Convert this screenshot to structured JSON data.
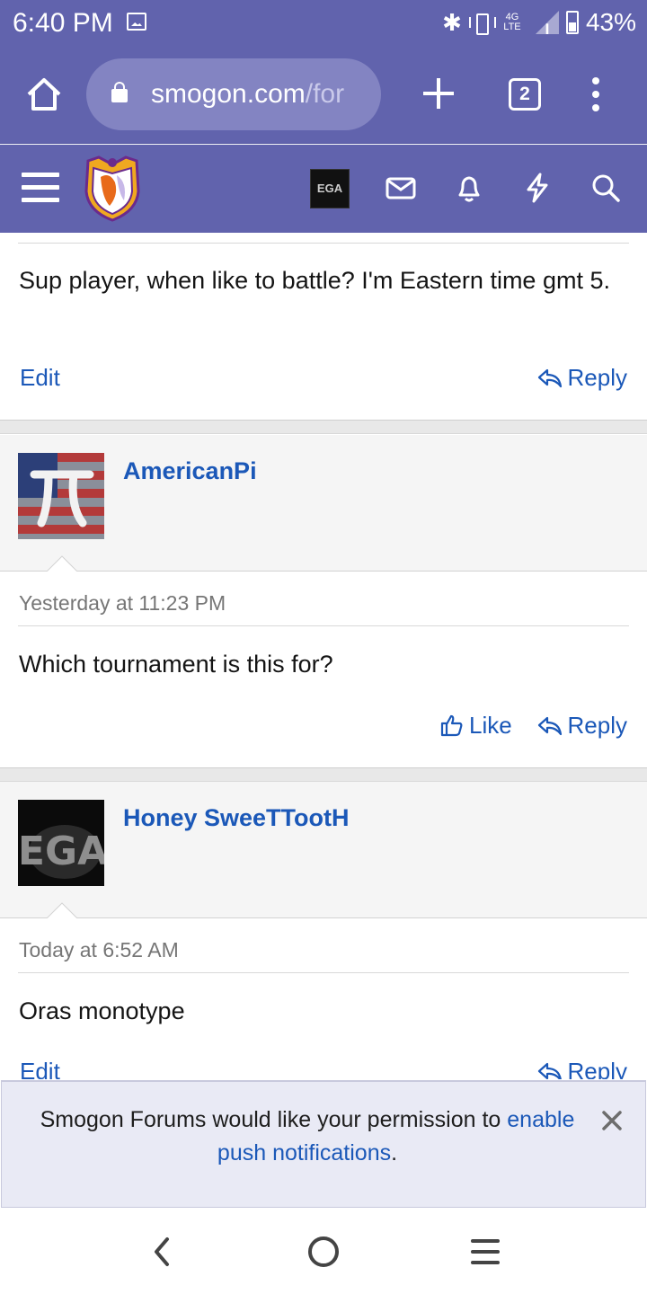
{
  "status_bar": {
    "time": "6:40 PM",
    "network": "4G LTE",
    "battery": "43%",
    "icons": [
      "gallery-icon",
      "bluetooth-icon",
      "vibrate-icon",
      "signal-icon",
      "battery-icon"
    ]
  },
  "browser": {
    "url_host": "smogon.com",
    "url_path": "/for",
    "tab_count": "2"
  },
  "forum_header": {
    "icons": [
      "menu-icon",
      "smogon-logo",
      "user-avatar",
      "mail-icon",
      "bell-icon",
      "bolt-icon",
      "search-icon"
    ],
    "avatar_text": "EGA"
  },
  "posts": [
    {
      "text": "Sup player, when like to battle? I'm Eastern time gmt 5.",
      "actions": {
        "edit": "Edit",
        "reply": "Reply"
      }
    },
    {
      "author": "AmericanPi",
      "timestamp": "Yesterday at 11:23 PM",
      "text": "Which tournament is this for?",
      "actions": {
        "like": "Like",
        "reply": "Reply"
      }
    },
    {
      "author": "Honey SweeTTootH",
      "avatar_text": "EGA",
      "timestamp": "Today at 6:52 AM",
      "text": "Oras monotype",
      "actions": {
        "edit": "Edit",
        "reply": "Reply"
      }
    }
  ],
  "push_banner": {
    "text_before": "Smogon Forums would like your permission to ",
    "link_text": "enable push notifications",
    "text_after": "."
  },
  "nav_bar": {
    "icons": [
      "back-icon",
      "home-icon",
      "recents-icon"
    ]
  },
  "colors": {
    "header_purple": "#6163ad",
    "link_blue": "#1b58b8",
    "banner_bg": "#e9eaf5"
  }
}
